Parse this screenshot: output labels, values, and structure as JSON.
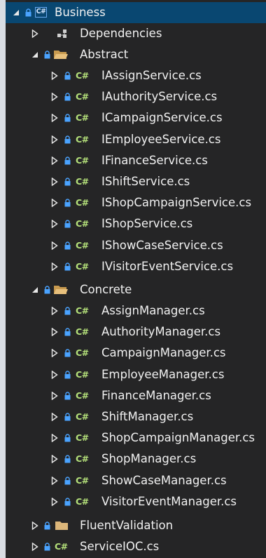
{
  "project": {
    "name": "Business",
    "icon": "csharp-project-icon"
  },
  "colors": {
    "background": "#252526",
    "selection": "#094771",
    "text": "#f1f1f1",
    "cs_icon": "#b4e07a",
    "folder": "#dcb67a",
    "lock": "#4aa3ff"
  },
  "dependencies": {
    "label": "Dependencies"
  },
  "abstract": {
    "label": "Abstract",
    "files": [
      "IAssignService.cs",
      "IAuthorityService.cs",
      "ICampaignService.cs",
      "IEmployeeService.cs",
      "IFinanceService.cs",
      "IShiftService.cs",
      "IShopCampaignService.cs",
      "IShopService.cs",
      "IShowCaseService.cs",
      "IVisitorEventService.cs"
    ]
  },
  "concrete": {
    "label": "Concrete",
    "files": [
      "AssignManager.cs",
      "AuthorityManager.cs",
      "CampaignManager.cs",
      "EmployeeManager.cs",
      "FinanceManager.cs",
      "ShiftManager.cs",
      "ShopCampaignManager.cs",
      "ShopManager.cs",
      "ShowCaseManager.cs",
      "VisitorEventManager.cs"
    ]
  },
  "fluent_validation": {
    "label": "FluentValidation"
  },
  "service_ioc": {
    "label": "ServiceIOC.cs"
  },
  "cs_glyph": "C#"
}
